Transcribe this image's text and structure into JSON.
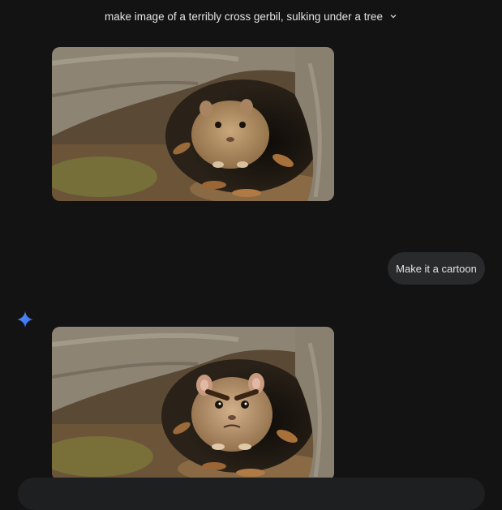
{
  "conversation": {
    "title": "make image of a terribly cross gerbil, sulking under a tree",
    "title_menu_icon": "chevron-down-icon"
  },
  "messages": [
    {
      "role": "model",
      "type": "image",
      "image_desc": "photo-gerbil-under-tree"
    },
    {
      "role": "user",
      "text": "Make it a cartoon"
    },
    {
      "role": "model",
      "type": "image",
      "image_desc": "cartoon-gerbil-with-angry-eyebrows",
      "avatar_icon": "gemini-sparkle-icon"
    }
  ],
  "colors": {
    "background": "#131314",
    "user_bubble": "#282a2c",
    "text": "#e3e3e3",
    "accent": "#4a90f0"
  }
}
